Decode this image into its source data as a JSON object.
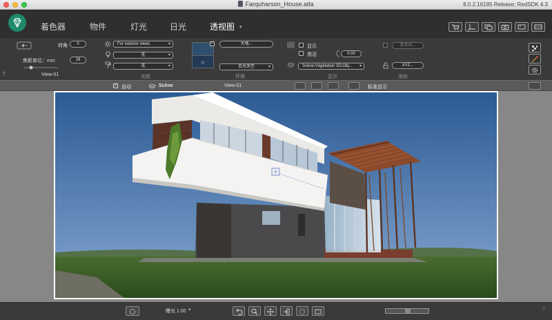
{
  "window": {
    "title": "Farquharson_House.atla",
    "version": "8.0.2.16195 Release; RedSDK 4.3"
  },
  "tabs": [
    {
      "label": "着色器",
      "active": false
    },
    {
      "label": "物件",
      "active": false
    },
    {
      "label": "灯光",
      "active": false
    },
    {
      "label": "日光",
      "active": false
    },
    {
      "label": "透视图",
      "active": true
    }
  ],
  "camera": {
    "rotation_label": "转角",
    "rotation_value": "0",
    "focal_label": "焦距单位：mm",
    "focal_value": "28",
    "view_name": "View-01"
  },
  "lighting": {
    "preset": "For exterior views",
    "option1": "无",
    "option2": "无",
    "section_label": "光效"
  },
  "environment": {
    "ground_button": "大地...",
    "sky": "日光天空",
    "section_label": "环境"
  },
  "display": {
    "show_label": "显示",
    "activate_label": "激活",
    "value": "0.00",
    "scene_select": "Scène;Végétation 3D;Obj...",
    "section_label": "显示"
  },
  "coords": {
    "base_button": "基准线...",
    "xyz_button": "XYZ...",
    "section_label": "坐标"
  },
  "strip": {
    "auto_label": "自动",
    "scene_label": "Scène",
    "view_label": "View-01",
    "standard_label": "标准显示"
  },
  "bottom": {
    "exposure_label": "曝光 1.00"
  },
  "colors": {
    "accent": "#1f8a6d",
    "sky_top": "#2b5a94",
    "sky_bottom": "#9dbad6"
  }
}
